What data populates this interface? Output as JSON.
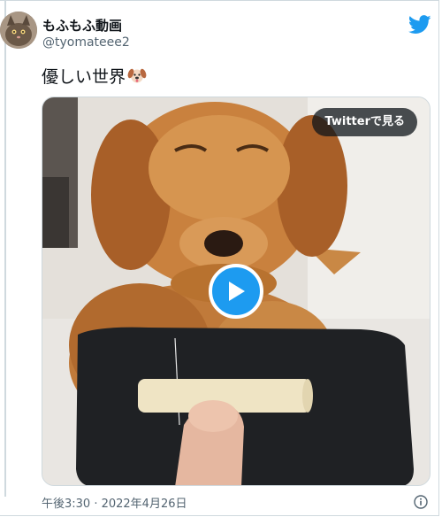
{
  "author": {
    "display_name": "もふもふ動画",
    "handle": "@tyomateee2"
  },
  "tweet": {
    "text": "優しい世界",
    "emoji": "dog-face-emoji"
  },
  "media": {
    "watch_label": "Twitterで見る",
    "play_icon": "play-icon"
  },
  "meta": {
    "timestamp": "午後3:30 · 2022年4月26日"
  },
  "colors": {
    "accent": "#1d9bf0",
    "text": "#0f1419",
    "secondary": "#536471",
    "border": "#cfd9de"
  }
}
